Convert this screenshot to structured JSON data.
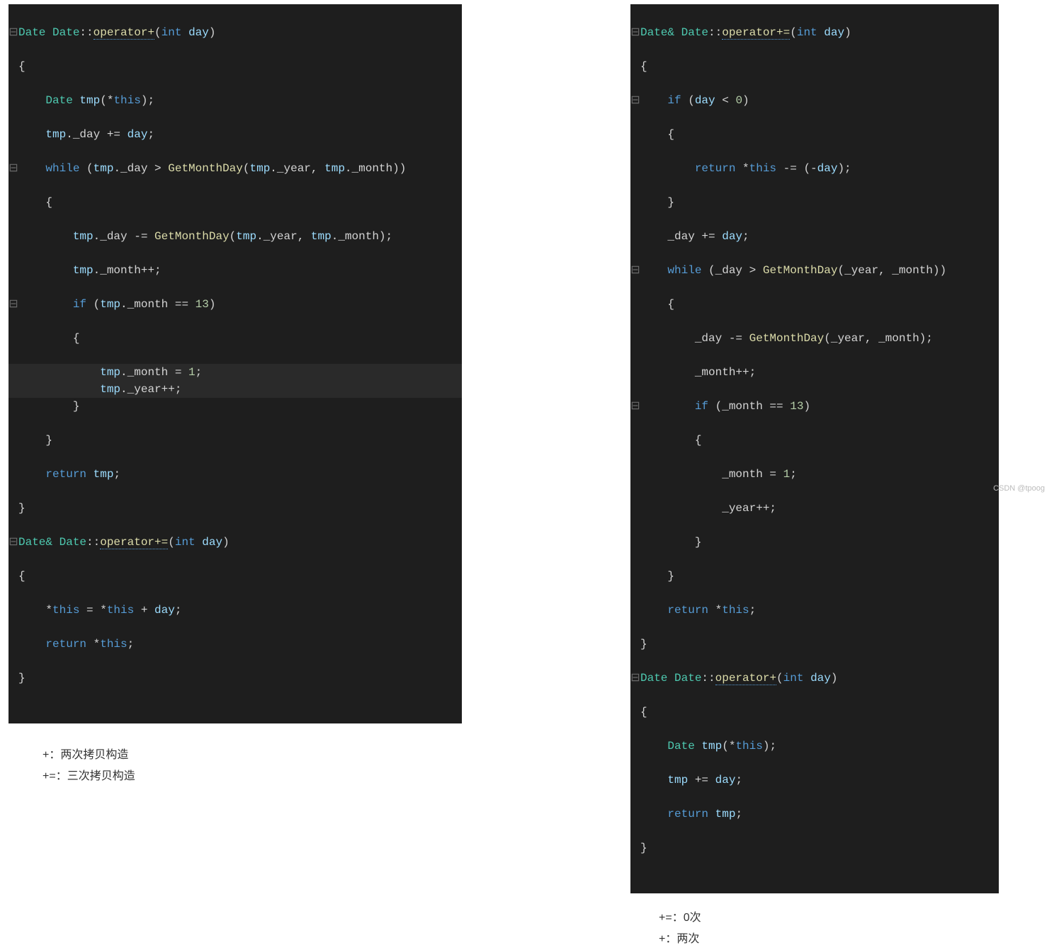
{
  "left": {
    "code": {
      "l1": {
        "g": "⊟",
        "t": "Date Date",
        "fn": "operator+",
        "p": "int",
        "a": "day"
      },
      "l2": {
        "g": " ",
        "t": "{"
      },
      "l3": {
        "g": " ",
        "indent": "    ",
        "t1": "Date ",
        "t2": "tmp",
        "t3": "(*",
        "t4": "this",
        "t5": ");"
      },
      "l4": {
        "g": " ",
        "indent": "    ",
        "t1": "tmp",
        "t2": "._day += ",
        "t3": "day",
        "t4": ";"
      },
      "l5": {
        "g": "⊟",
        "indent": "    ",
        "kw": "while",
        "t1": " (",
        "t2": "tmp",
        "t3": "._day > ",
        "fn": "GetMonthDay",
        "t4": "(",
        "t5": "tmp",
        "t6": "._year, ",
        "t7": "tmp",
        "t8": "._month))"
      },
      "l6": {
        "g": " ",
        "indent": "    ",
        "t": "{"
      },
      "l7": {
        "g": " ",
        "indent": "        ",
        "t1": "tmp",
        "t2": "._day -= ",
        "fn": "GetMonthDay",
        "t3": "(",
        "t4": "tmp",
        "t5": "._year, ",
        "t6": "tmp",
        "t7": "._month);"
      },
      "l8": {
        "g": " ",
        "indent": "        ",
        "t1": "tmp",
        "t2": "._month++;"
      },
      "l9": {
        "g": "⊟",
        "indent": "        ",
        "kw": "if",
        "t1": " (",
        "t2": "tmp",
        "t3": "._month == ",
        "n": "13",
        "t4": ")"
      },
      "l10": {
        "g": " ",
        "indent": "        ",
        "t": "{"
      },
      "l11": {
        "g": " ",
        "indent": "            ",
        "t1": "tmp",
        "t2": "._month = ",
        "n": "1",
        "t3": ";"
      },
      "l12": {
        "g": " ",
        "indent": "            ",
        "t1": "tmp",
        "t2": "._year++;"
      },
      "l13": {
        "g": " ",
        "indent": "        ",
        "t": "}"
      },
      "l14": {
        "g": " ",
        "indent": "    ",
        "t": "}"
      },
      "l15": {
        "g": " ",
        "indent": "    ",
        "kw": "return",
        "t1": " ",
        "t2": "tmp",
        "t3": ";"
      },
      "l16": {
        "g": " ",
        "t": "}"
      },
      "l17": {
        "g": "⊟",
        "t1": "Date",
        "t2": "& Date",
        "fn": "operator+=",
        "p": "int",
        "a": "day"
      },
      "l18": {
        "g": " ",
        "t": "{"
      },
      "l19": {
        "g": " ",
        "indent": "    ",
        "t1": "*",
        "t2": "this",
        "t3": " = *",
        "t4": "this",
        "t5": " + ",
        "t6": "day",
        "t7": ";"
      },
      "l20": {
        "g": " ",
        "indent": "    ",
        "kw": "return",
        "t1": " *",
        "t2": "this",
        "t3": ";"
      },
      "l21": {
        "g": " ",
        "t": "}"
      }
    },
    "caption1": "+：两次拷贝构造",
    "caption2": "+=：三次拷贝构造"
  },
  "right": {
    "code": {
      "l1": {
        "g": "⊟",
        "t1": "Date",
        "t2": "& Date",
        "fn": "operator+=",
        "p": "int",
        "a": "day"
      },
      "l2": {
        "g": " ",
        "t": "{"
      },
      "l3": {
        "g": "⊟",
        "indent": "    ",
        "kw": "if",
        "t1": " (",
        "t2": "day",
        "t3": " < ",
        "n": "0",
        "t4": ")"
      },
      "l4": {
        "g": " ",
        "indent": "    ",
        "t": "{"
      },
      "l5": {
        "g": " ",
        "indent": "        ",
        "kw": "return",
        "t1": " *",
        "t2": "this",
        "t3": " -= (-",
        "t4": "day",
        "t5": ");"
      },
      "l6": {
        "g": " ",
        "indent": "    ",
        "t": "}"
      },
      "l7": {
        "g": " ",
        "indent": "    ",
        "t1": "_day += ",
        "t2": "day",
        "t3": ";"
      },
      "l8": {
        "g": "⊟",
        "indent": "    ",
        "kw": "while",
        "t1": " (_day > ",
        "fn": "GetMonthDay",
        "t2": "(_year, _month))"
      },
      "l9": {
        "g": " ",
        "indent": "    ",
        "t": "{"
      },
      "l10": {
        "g": " ",
        "indent": "        ",
        "t1": "_day -= ",
        "fn": "GetMonthDay",
        "t2": "(_year, _month);"
      },
      "l11": {
        "g": " ",
        "indent": "        ",
        "t": "_month++;"
      },
      "l12": {
        "g": "⊟",
        "indent": "        ",
        "kw": "if",
        "t1": " (_month == ",
        "n": "13",
        "t2": ")"
      },
      "l13": {
        "g": " ",
        "indent": "        ",
        "t": "{"
      },
      "l14": {
        "g": " ",
        "indent": "            ",
        "t1": "_month = ",
        "n": "1",
        "t2": ";"
      },
      "l15": {
        "g": " ",
        "indent": "            ",
        "t": "_year++;"
      },
      "l16": {
        "g": " ",
        "indent": "        ",
        "t": "}"
      },
      "l17": {
        "g": " ",
        "indent": "    ",
        "t": "}"
      },
      "l18": {
        "g": " ",
        "indent": "    ",
        "kw": "return",
        "t1": " *",
        "t2": "this",
        "t3": ";"
      },
      "l19": {
        "g": " ",
        "t": "}"
      },
      "l20": {
        "g": "⊟",
        "t1": "Date Date",
        "fn": "operator+",
        "p": "int",
        "a": "day"
      },
      "l21": {
        "g": " ",
        "t": "{"
      },
      "l22": {
        "g": " ",
        "indent": "    ",
        "t1": "Date ",
        "t2": "tmp",
        "t3": "(*",
        "t4": "this",
        "t5": ");"
      },
      "l23": {
        "g": " ",
        "indent": "    ",
        "t1": "tmp",
        "t2": " += ",
        "t3": "day",
        "t4": ";"
      },
      "l24": {
        "g": " ",
        "indent": "    ",
        "kw": "return",
        "t1": " ",
        "t2": "tmp",
        "t3": ";"
      },
      "l25": {
        "g": " ",
        "t": "}"
      }
    },
    "caption1": "+=：0次",
    "caption2": "+：两次"
  },
  "watermark": "CSDN @tpoog"
}
